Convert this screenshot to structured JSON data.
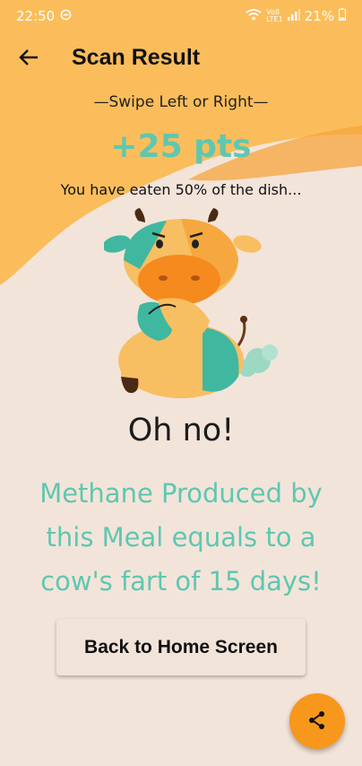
{
  "status_bar": {
    "time": "22:50",
    "dnd_icon": "do-not-disturb-icon",
    "wifi_icon": "wifi-icon",
    "volte_top": "Vo8",
    "volte_bottom": "LTE1",
    "signal_icon": "signal-icon",
    "battery": "21%",
    "battery_icon": "battery-icon"
  },
  "header": {
    "back_icon": "arrow-left-icon",
    "title": "Scan Result"
  },
  "result": {
    "swipe_hint": "—Swipe Left or Right—",
    "points": "+25 pts",
    "eaten_text": "You have eaten 50% of the dish...",
    "mascot": "cow-mascot-illustration",
    "reaction": "Oh no!",
    "message": "Methane Produced by this Meal equals to a cow's fart of 15 days!"
  },
  "actions": {
    "home_button": "Back to Home Screen",
    "share_icon": "share-icon"
  },
  "colors": {
    "background": "#f3e4da",
    "header_orange": "#fbbd5b",
    "accent_teal": "#5fc7b0",
    "fab_orange": "#f7981c"
  }
}
